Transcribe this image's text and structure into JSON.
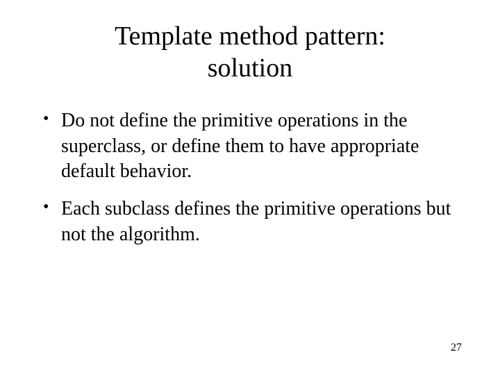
{
  "title_line1": "Template method pattern:",
  "title_line2": "solution",
  "bullets": [
    "Do not define the primitive operations in the superclass, or define them to have appropriate default behavior.",
    "Each subclass defines the primitive operations but not the algorithm."
  ],
  "page_number": "27"
}
